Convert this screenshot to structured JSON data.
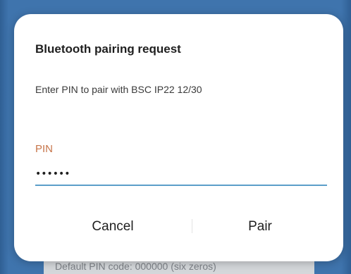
{
  "background": {
    "hint_text": "Default PIN code: 000000 (six zeros)"
  },
  "dialog": {
    "title": "Bluetooth pairing request",
    "message": "Enter PIN to pair with BSC IP22 12/30",
    "pin_label": "PIN",
    "pin_value": "••••••",
    "cancel_label": "Cancel",
    "pair_label": "Pair"
  },
  "colors": {
    "backdrop": "#3f74ad",
    "pin_label": "#c7754a",
    "input_underline": "#5b9ec9",
    "dialog_bg": "#ffffff"
  }
}
